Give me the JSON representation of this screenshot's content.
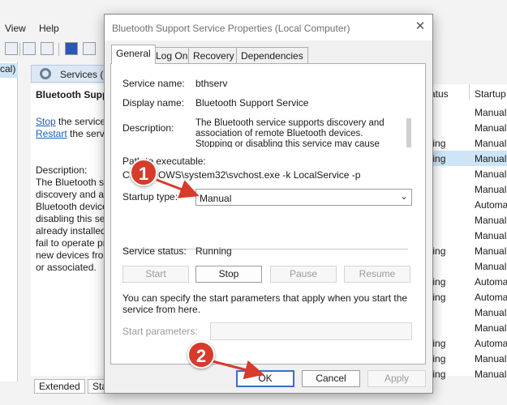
{
  "background": {
    "menu": [
      "View",
      "Help"
    ],
    "tree_label": "cal)",
    "header_title": "Services (L",
    "service_name": "Bluetooth Supp",
    "stop_link": "Stop",
    "stop_rest": " the service",
    "restart_link": "Restart",
    "restart_rest": " the servic",
    "description_heading": "Description:",
    "description_lines": [
      "The Bluetooth se",
      "discovery and as",
      "Bluetooth device",
      "disabling this se",
      "already installed",
      "fail to operate pr",
      "new devices from",
      "or associated."
    ],
    "bottom_tabs": [
      "Extended",
      "Sta"
    ],
    "columns": {
      "status": "atus",
      "startup": "Startup"
    },
    "rows": [
      {
        "status": "",
        "startup": "Manual"
      },
      {
        "status": "",
        "startup": "Manual"
      },
      {
        "status": "nning",
        "startup": "Manual"
      },
      {
        "status": "nning",
        "startup": "Manual",
        "selected": true
      },
      {
        "status": "",
        "startup": "Manual"
      },
      {
        "status": "",
        "startup": "Manual"
      },
      {
        "status": "",
        "startup": "Automa"
      },
      {
        "status": "",
        "startup": "Manual"
      },
      {
        "status": "",
        "startup": "Manual"
      },
      {
        "status": "nning",
        "startup": "Manual"
      },
      {
        "status": "",
        "startup": "Manual"
      },
      {
        "status": "nning",
        "startup": "Automa"
      },
      {
        "status": "nning",
        "startup": "Automa"
      },
      {
        "status": "",
        "startup": "Manual"
      },
      {
        "status": "",
        "startup": "Manual"
      },
      {
        "status": "nning",
        "startup": "Automa"
      },
      {
        "status": "nning",
        "startup": "Manual"
      },
      {
        "status": "nning",
        "startup": "Manual"
      }
    ]
  },
  "dialog": {
    "title": "Bluetooth Support Service Properties (Local Computer)",
    "tabs": [
      "General",
      "Log On",
      "Recovery",
      "Dependencies"
    ],
    "service_name_label": "Service name:",
    "service_name_value": "bthserv",
    "display_name_label": "Display name:",
    "display_name_value": "Bluetooth Support Service",
    "description_label": "Description:",
    "description_value": "The Bluetooth service supports discovery and association of remote Bluetooth devices.  Stopping or disabling this service may cause already installed",
    "path_label": "Path to executable:",
    "path_value_visible": "C:",
    "path_value_rest": "OWS\\system32\\svchost.exe -k LocalService -p",
    "startup_type_label": "Startup type:",
    "startup_type_value": "Manual",
    "service_status_label": "Service status:",
    "service_status_value": "Running",
    "buttons": {
      "start": "Start",
      "stop": "Stop",
      "pause": "Pause",
      "resume": "Resume"
    },
    "help_text": "You can specify the start parameters that apply when you start the service from here.",
    "start_params_label": "Start parameters:",
    "ok": "OK",
    "cancel": "Cancel",
    "apply": "Apply"
  },
  "annotations": {
    "badge1": "1",
    "badge2": "2",
    "color": "#d63b2c"
  }
}
